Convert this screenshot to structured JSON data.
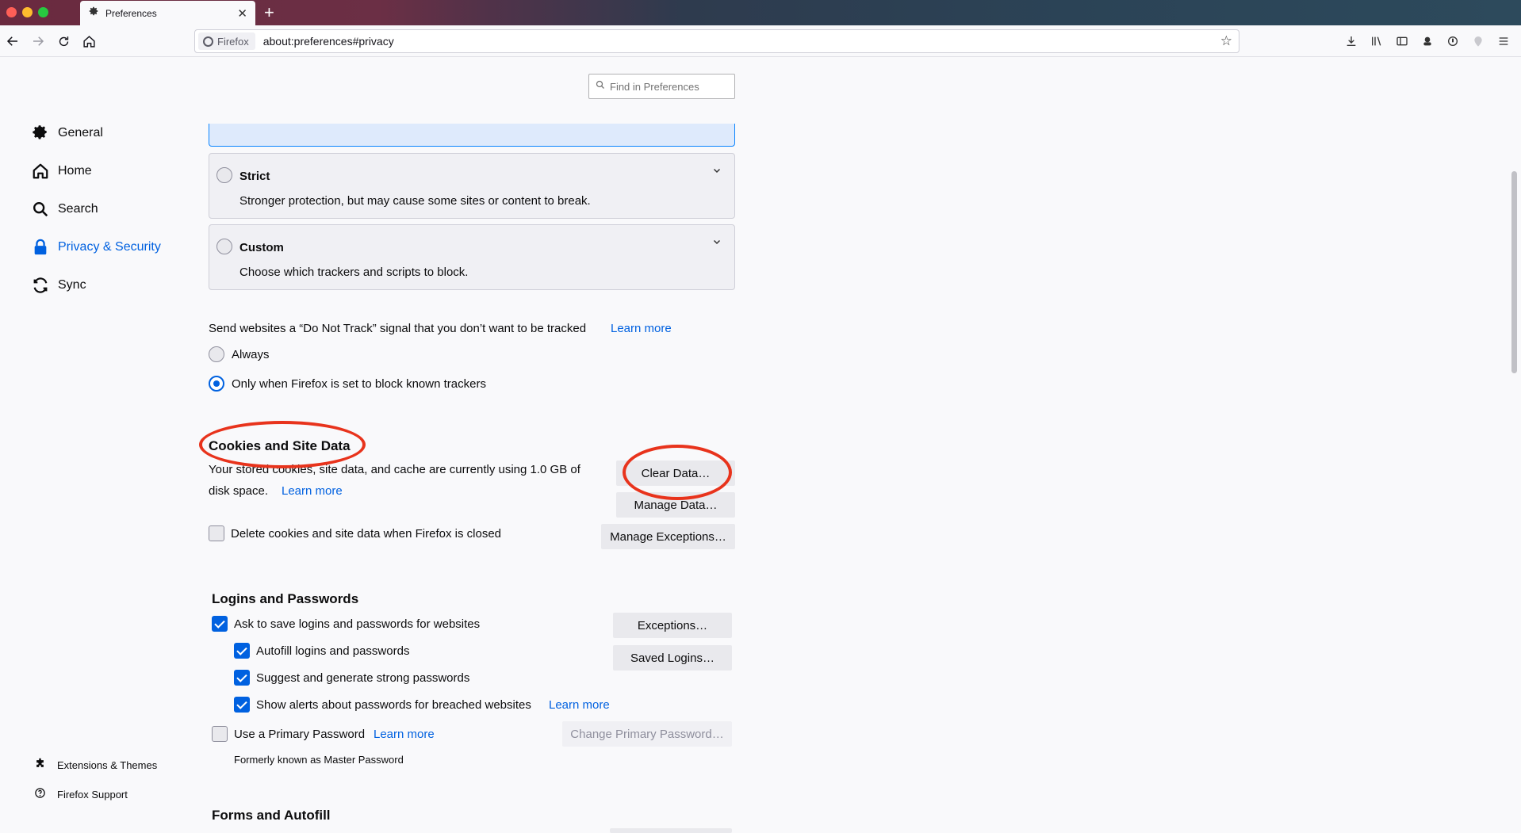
{
  "tab": {
    "title": "Preferences",
    "close": "✕",
    "new_tab": "+"
  },
  "urlbar": {
    "identity": "Firefox",
    "url": "about:preferences#privacy"
  },
  "sidebar": {
    "items": [
      {
        "label": "General",
        "icon": "gear-icon"
      },
      {
        "label": "Home",
        "icon": "home-icon"
      },
      {
        "label": "Search",
        "icon": "search-icon"
      },
      {
        "label": "Privacy & Security",
        "icon": "lock-icon",
        "selected": true
      },
      {
        "label": "Sync",
        "icon": "sync-icon"
      }
    ],
    "footer": [
      {
        "label": "Extensions & Themes",
        "icon": "puzzle-icon"
      },
      {
        "label": "Firefox Support",
        "icon": "help-icon"
      }
    ]
  },
  "search": {
    "placeholder": "Find in Preferences"
  },
  "tracking": {
    "options": [
      {
        "title": "Strict",
        "desc": "Stronger protection, but may cause some sites or content to break."
      },
      {
        "title": "Custom",
        "desc": "Choose which trackers and scripts to block."
      }
    ]
  },
  "dnt": {
    "text": "Send websites a “Do Not Track” signal that you don’t want to be tracked",
    "learn_more": "Learn more",
    "options": [
      "Always",
      "Only when Firefox is set to block known trackers"
    ],
    "selected_index": 1
  },
  "cookies": {
    "heading": "Cookies and Site Data",
    "usage_line1": "Your stored cookies, site data, and cache are currently using 1.0 GB of",
    "usage_line2": "disk space.",
    "learn_more": "Learn more",
    "clear_btn": "Clear Data…",
    "manage_btn": "Manage Data…",
    "exceptions_btn": "Manage Exceptions…",
    "delete_label": "Delete cookies and site data when Firefox is closed"
  },
  "logins": {
    "heading": "Logins and Passwords",
    "ask_save": "Ask to save logins and passwords for websites",
    "autofill": "Autofill logins and passwords",
    "suggest": "Suggest and generate strong passwords",
    "breach_alerts": "Show alerts about passwords for breached websites",
    "breach_learn_more": "Learn more",
    "primary_password": "Use a Primary Password",
    "primary_learn_more": "Learn more",
    "formerly": "Formerly known as Master Password",
    "exceptions_btn": "Exceptions…",
    "saved_logins_btn": "Saved Logins…",
    "change_primary_btn": "Change Primary Password…"
  },
  "forms": {
    "heading": "Forms and Autofill"
  },
  "colors": {
    "accent": "#0061e0",
    "annotation": "#e8331c"
  }
}
